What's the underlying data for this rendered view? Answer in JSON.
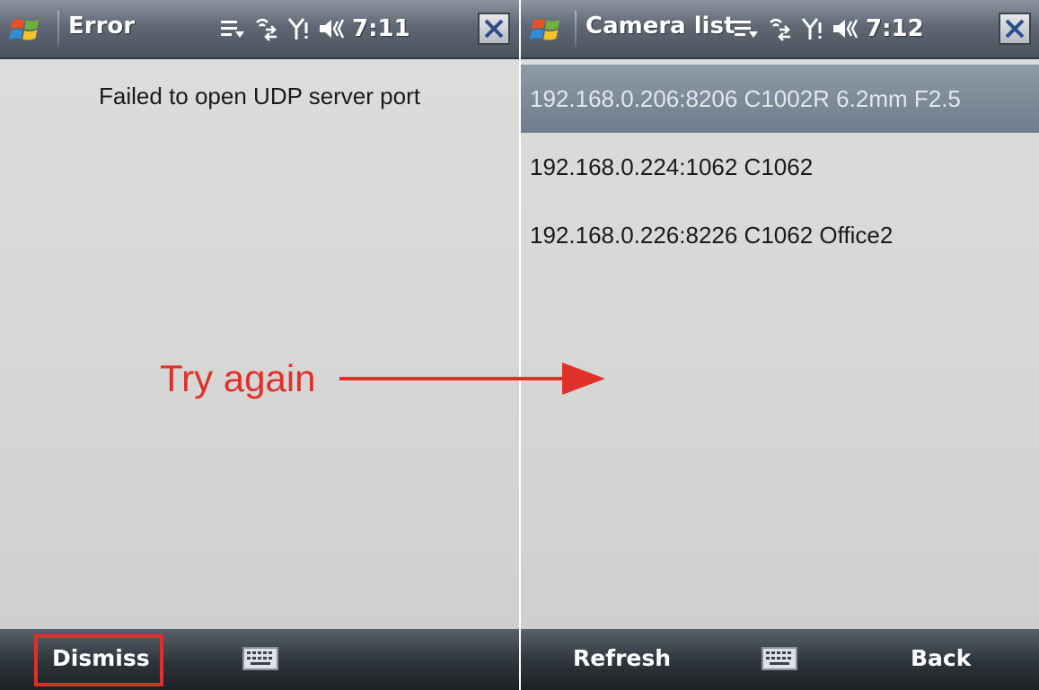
{
  "left_screen": {
    "title": "Error",
    "time": "7:11",
    "message": "Failed to open UDP server port",
    "softkeys": {
      "left": "Dismiss"
    }
  },
  "right_screen": {
    "title": "Camera list",
    "time": "7:12",
    "cameras": [
      {
        "label": "192.168.0.206:8206 C1002R 6.2mm F2.5",
        "selected": true
      },
      {
        "label": "192.168.0.224:1062 C1062",
        "selected": false
      },
      {
        "label": "192.168.0.226:8226 C1062 Office2",
        "selected": false
      }
    ],
    "softkeys": {
      "left": "Refresh",
      "right": "Back"
    }
  },
  "annotation": {
    "text": "Try again",
    "color": "#e1302a"
  },
  "colors": {
    "titlebar": "#5f6874",
    "softbar": "#2e343b",
    "selection": "#7d8a98",
    "highlight_box": "#e0302a"
  },
  "icons": {
    "start": "windows-start-icon",
    "notifications": "notification-icon",
    "connectivity": "connectivity-icon",
    "signal": "signal-icon",
    "volume": "volume-icon",
    "close": "close-icon",
    "keyboard": "keyboard-icon"
  }
}
